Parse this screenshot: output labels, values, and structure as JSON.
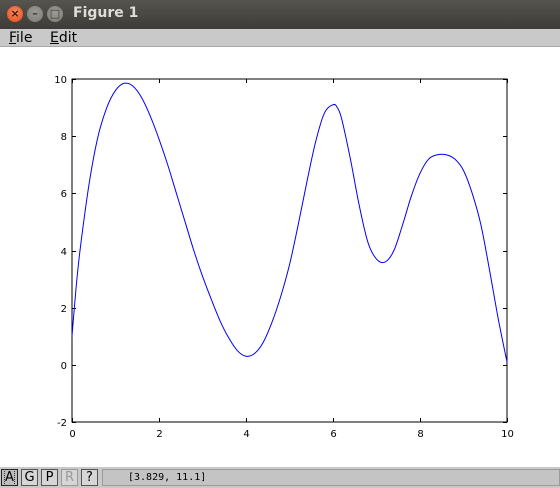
{
  "window": {
    "title": "Figure 1",
    "close_glyph": "×",
    "min_glyph": "–",
    "max_glyph": "□"
  },
  "menu": {
    "file_mnemonic": "F",
    "file_rest": "ile",
    "edit_mnemonic": "E",
    "edit_rest": "dit"
  },
  "toolbar": {
    "a": "A",
    "g": "G",
    "p": "P",
    "r": "R",
    "help": "?"
  },
  "status": {
    "coords": "[3.829, 11.1]"
  },
  "colors": {
    "line": "#0000ff",
    "axes": "#000000"
  },
  "chart_data": {
    "type": "line",
    "xlim": [
      0,
      10
    ],
    "ylim": [
      -2,
      10
    ],
    "xticks": [
      0,
      2,
      4,
      6,
      8,
      10
    ],
    "yticks": [
      -2,
      0,
      2,
      4,
      6,
      8,
      10
    ],
    "grid": false,
    "series": [
      {
        "x": [
          0,
          0.1,
          0.2,
          0.4,
          0.6,
          0.8,
          1.0,
          1.2,
          1.4,
          1.6,
          1.8,
          2.0,
          2.2,
          2.4,
          2.6,
          2.8,
          3.0,
          3.2,
          3.4,
          3.6,
          3.8,
          4.0,
          4.2,
          4.4,
          4.6,
          4.8,
          5.0,
          5.2,
          5.4,
          5.6,
          5.8,
          6.0,
          6.1,
          6.2,
          6.4,
          6.6,
          6.8,
          7.0,
          7.2,
          7.4,
          7.6,
          7.8,
          8.0,
          8.2,
          8.4,
          8.6,
          8.8,
          9.0,
          9.2,
          9.4,
          9.6,
          9.8,
          10.0
        ],
        "y": [
          1.0,
          2.8,
          4.2,
          6.4,
          8.0,
          9.0,
          9.6,
          9.85,
          9.75,
          9.35,
          8.7,
          7.9,
          7.0,
          6.0,
          5.0,
          4.0,
          3.1,
          2.3,
          1.55,
          0.95,
          0.5,
          0.3,
          0.4,
          0.8,
          1.5,
          2.4,
          3.5,
          4.9,
          6.4,
          7.8,
          8.8,
          9.1,
          9.0,
          8.6,
          7.2,
          5.6,
          4.3,
          3.7,
          3.6,
          4.0,
          4.9,
          5.9,
          6.7,
          7.2,
          7.35,
          7.35,
          7.2,
          6.8,
          6.0,
          4.9,
          3.3,
          1.6,
          0.1
        ]
      }
    ]
  }
}
